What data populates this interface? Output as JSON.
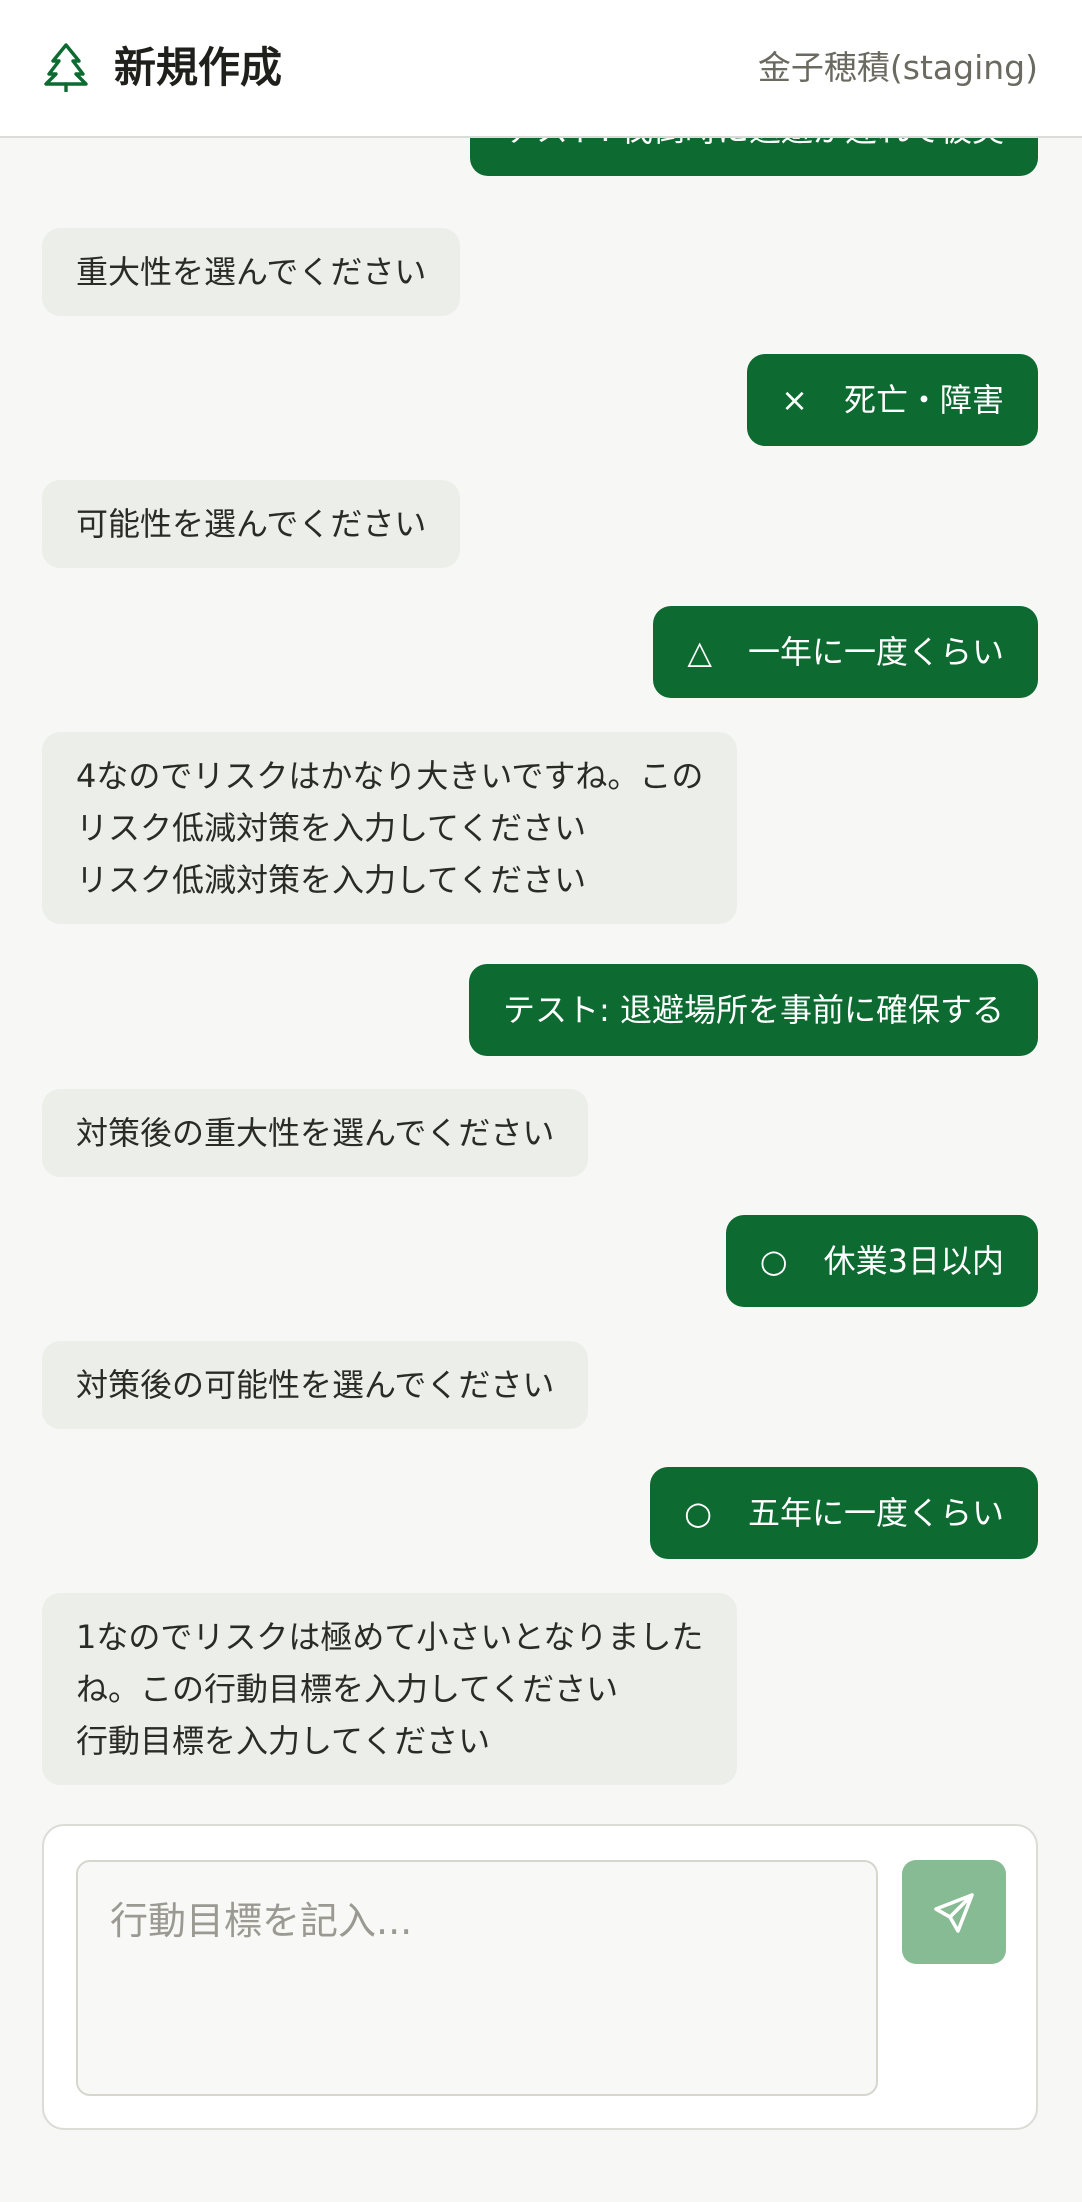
{
  "header": {
    "title": "新規作成",
    "user": "金子穂積(staging)"
  },
  "messages": [
    {
      "role": "user",
      "text": "テスト: 伐倒時に退避が遅れて被災"
    },
    {
      "role": "bot",
      "lines": [
        "重大性を選んでください"
      ]
    },
    {
      "role": "user",
      "mark": "×",
      "text": "死亡・障害"
    },
    {
      "role": "bot",
      "lines": [
        "可能性を選んでください"
      ]
    },
    {
      "role": "user",
      "mark": "△",
      "text": "一年に一度くらい"
    },
    {
      "role": "bot",
      "lines": [
        "4なのでリスクはかなり大きいですね。この",
        "リスク低減対策を入力してください",
        "リスク低減対策を入力してください"
      ]
    },
    {
      "role": "user",
      "text": "テスト: 退避場所を事前に確保する"
    },
    {
      "role": "bot",
      "lines": [
        "対策後の重大性を選んでください"
      ]
    },
    {
      "role": "user",
      "mark": "○",
      "text": "休業3日以内"
    },
    {
      "role": "bot",
      "lines": [
        "対策後の可能性を選んでください"
      ]
    },
    {
      "role": "user",
      "mark": "○",
      "text": "五年に一度くらい"
    },
    {
      "role": "bot",
      "lines": [
        "1なのでリスクは極めて小さいとなりました",
        "ね。この行動目標を入力してください",
        "行動目標を入力してください"
      ]
    }
  ],
  "composer": {
    "placeholder": "行動目標を記入...",
    "value": ""
  },
  "icons": {
    "logo": "tree-icon",
    "send": "send-icon"
  },
  "colors": {
    "primary": "#0d6a31",
    "bot_bubble": "#eceee9",
    "send_disabled": "#86bb93",
    "background": "#f7f8f5"
  }
}
